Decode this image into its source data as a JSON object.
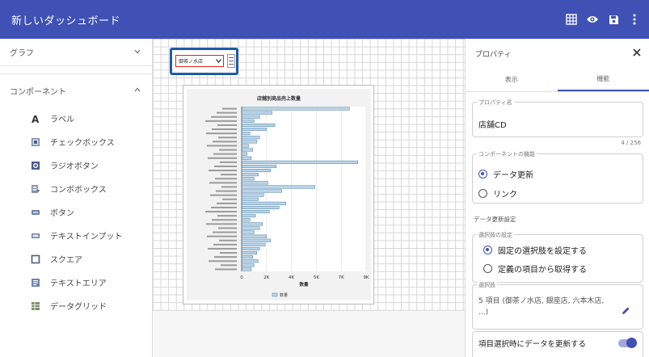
{
  "app": {
    "title": "新しいダッシュボード"
  },
  "left": {
    "graph_header": "グラフ",
    "components_header": "コンポーネント",
    "components": [
      {
        "label": "ラベル",
        "icon": "label-a-icon"
      },
      {
        "label": "チェックボックス",
        "icon": "checkbox-icon"
      },
      {
        "label": "ラジオボタン",
        "icon": "radio-button-icon"
      },
      {
        "label": "コンボボックス",
        "icon": "combobox-icon"
      },
      {
        "label": "ボタン",
        "icon": "button-icon"
      },
      {
        "label": "テキストインプット",
        "icon": "text-input-icon"
      },
      {
        "label": "スクエア",
        "icon": "square-icon"
      },
      {
        "label": "テキストエリア",
        "icon": "textarea-icon"
      },
      {
        "label": "データグリッド",
        "icon": "datagrid-icon"
      }
    ]
  },
  "canvas": {
    "select_value": "御茶ノ水店"
  },
  "chart_data": {
    "type": "bar",
    "orientation": "horizontal",
    "title": "店舗別商品売上数量",
    "xlabel": "数量",
    "xticks": [
      "0",
      "2K",
      "4K",
      "5K",
      "7K",
      "9K"
    ],
    "xlim": [
      0,
      9000
    ],
    "legend": [
      "数量"
    ],
    "series": [
      {
        "name": "数量",
        "values": [
          7800,
          2200,
          1300,
          900,
          2400,
          1800,
          600,
          1300,
          1100,
          500,
          800,
          400,
          700,
          8400,
          2500,
          2100,
          1200,
          900,
          1900,
          5300,
          2900,
          1600,
          1200,
          3200,
          2700,
          2000,
          1000,
          600,
          1500,
          1300,
          900,
          1800,
          2100,
          1700,
          1300,
          1100,
          800,
          1200,
          900,
          700
        ]
      }
    ],
    "colors": {
      "bar": "#b9d3e8",
      "bar_border": "#2f6a8f"
    }
  },
  "right": {
    "title": "プロパティ",
    "tabs": [
      "表示",
      "機能"
    ],
    "property_name_label": "プロパティ名",
    "property_name_value": "店舗CD",
    "char_count": "4 / 256",
    "component_function_label": "コンポーネントの機能",
    "function_options": [
      "データ更新",
      "リンク"
    ],
    "data_update_settings": "データ更新設定",
    "choice_settings_label": "選択肢の設定",
    "choice_options": [
      "固定の選択肢を設定する",
      "定義の項目から取得する"
    ],
    "choices_label": "選択肢",
    "choices_value": "5 項目 (御茶ノ水店, 銀座店, 六本木店, ...)",
    "toggle_label": "項目選択時にデータを更新する"
  },
  "colors": {
    "primary": "#3f51b5",
    "highlight": "#1f5aa8",
    "select_border": "#dd2222"
  }
}
